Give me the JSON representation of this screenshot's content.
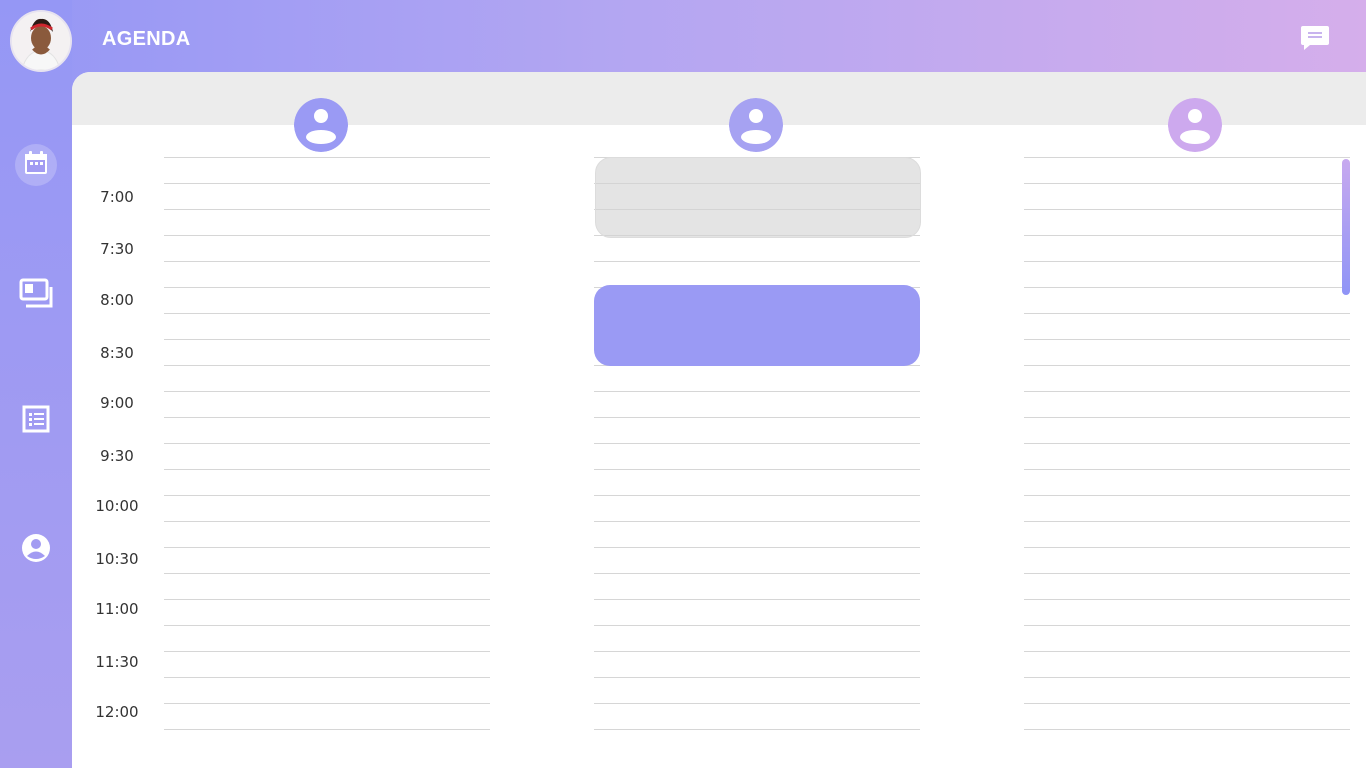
{
  "app": {
    "title": "AGENDA"
  },
  "colors": {
    "accent": "#9a9af4",
    "accent_light": "#d5aeeb",
    "gray_event": "#e2e2e2",
    "header_bar": "#ececec"
  },
  "sidebar": {
    "items": [
      {
        "name": "calendar",
        "icon": "calendar-icon",
        "active": true
      },
      {
        "name": "slides",
        "icon": "slides-icon",
        "active": false
      },
      {
        "name": "list",
        "icon": "list-icon",
        "active": false
      },
      {
        "name": "profile",
        "icon": "account-icon",
        "active": false
      }
    ]
  },
  "header": {
    "chat_icon": "chat-icon"
  },
  "agenda": {
    "times": [
      "7:00",
      "7:30",
      "8:00",
      "8:30",
      "9:00",
      "9:30",
      "10:00",
      "10:30",
      "11:00",
      "11:30",
      "12:00"
    ],
    "people": [
      {
        "icon": "person-icon",
        "color": "#9a9af4"
      },
      {
        "icon": "person-icon",
        "color": "#a6a2f2"
      },
      {
        "icon": "person-icon",
        "color": "#cda9ee"
      }
    ],
    "events": [
      {
        "person": 1,
        "kind": "unavailable",
        "start": "6:45",
        "end": "7:30"
      },
      {
        "person": 1,
        "kind": "booked",
        "start": "8:00",
        "end": "8:45"
      }
    ]
  }
}
